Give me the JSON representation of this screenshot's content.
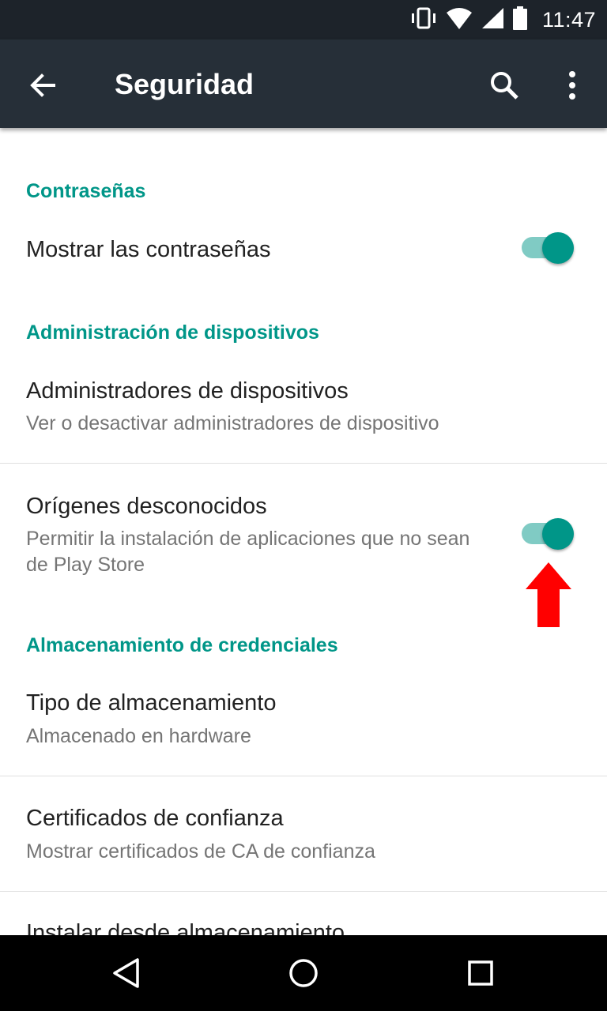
{
  "status_bar": {
    "time": "11:47",
    "icons": [
      "vibrate-icon",
      "wifi-icon",
      "signal-icon",
      "battery-icon"
    ]
  },
  "app_bar": {
    "title": "Seguridad",
    "icons": [
      "back-arrow-icon",
      "search-icon",
      "more-vert-icon"
    ]
  },
  "sections": {
    "passwords": {
      "header": "Contraseñas",
      "show_passwords": {
        "title": "Mostrar las contraseñas",
        "enabled": true
      }
    },
    "device_admin": {
      "header": "Administración de dispositivos",
      "admins": {
        "title": "Administradores de dispositivos",
        "subtitle": "Ver o desactivar administradores de dispositivo"
      },
      "unknown_sources": {
        "title": "Orígenes desconocidos",
        "subtitle": "Permitir la instalación de aplicaciones que no sean de Play Store",
        "enabled": true
      }
    },
    "credentials": {
      "header": "Almacenamiento de credenciales",
      "storage_type": {
        "title": "Tipo de almacenamiento",
        "subtitle": "Almacenado en hardware"
      },
      "trusted_certs": {
        "title": "Certificados de confianza",
        "subtitle": "Mostrar certificados de CA de confianza"
      },
      "install_from_storage": {
        "title": "Instalar desde almacenamiento"
      }
    }
  },
  "annotation": {
    "arrow_color": "#ff0000"
  },
  "colors": {
    "accent": "#009688",
    "accent_light": "#80cbc4",
    "app_bar": "#262f38",
    "status_bar": "#1d232a"
  },
  "nav_bar": {
    "icons": [
      "back-triangle-icon",
      "home-circle-icon",
      "recents-square-icon"
    ]
  }
}
